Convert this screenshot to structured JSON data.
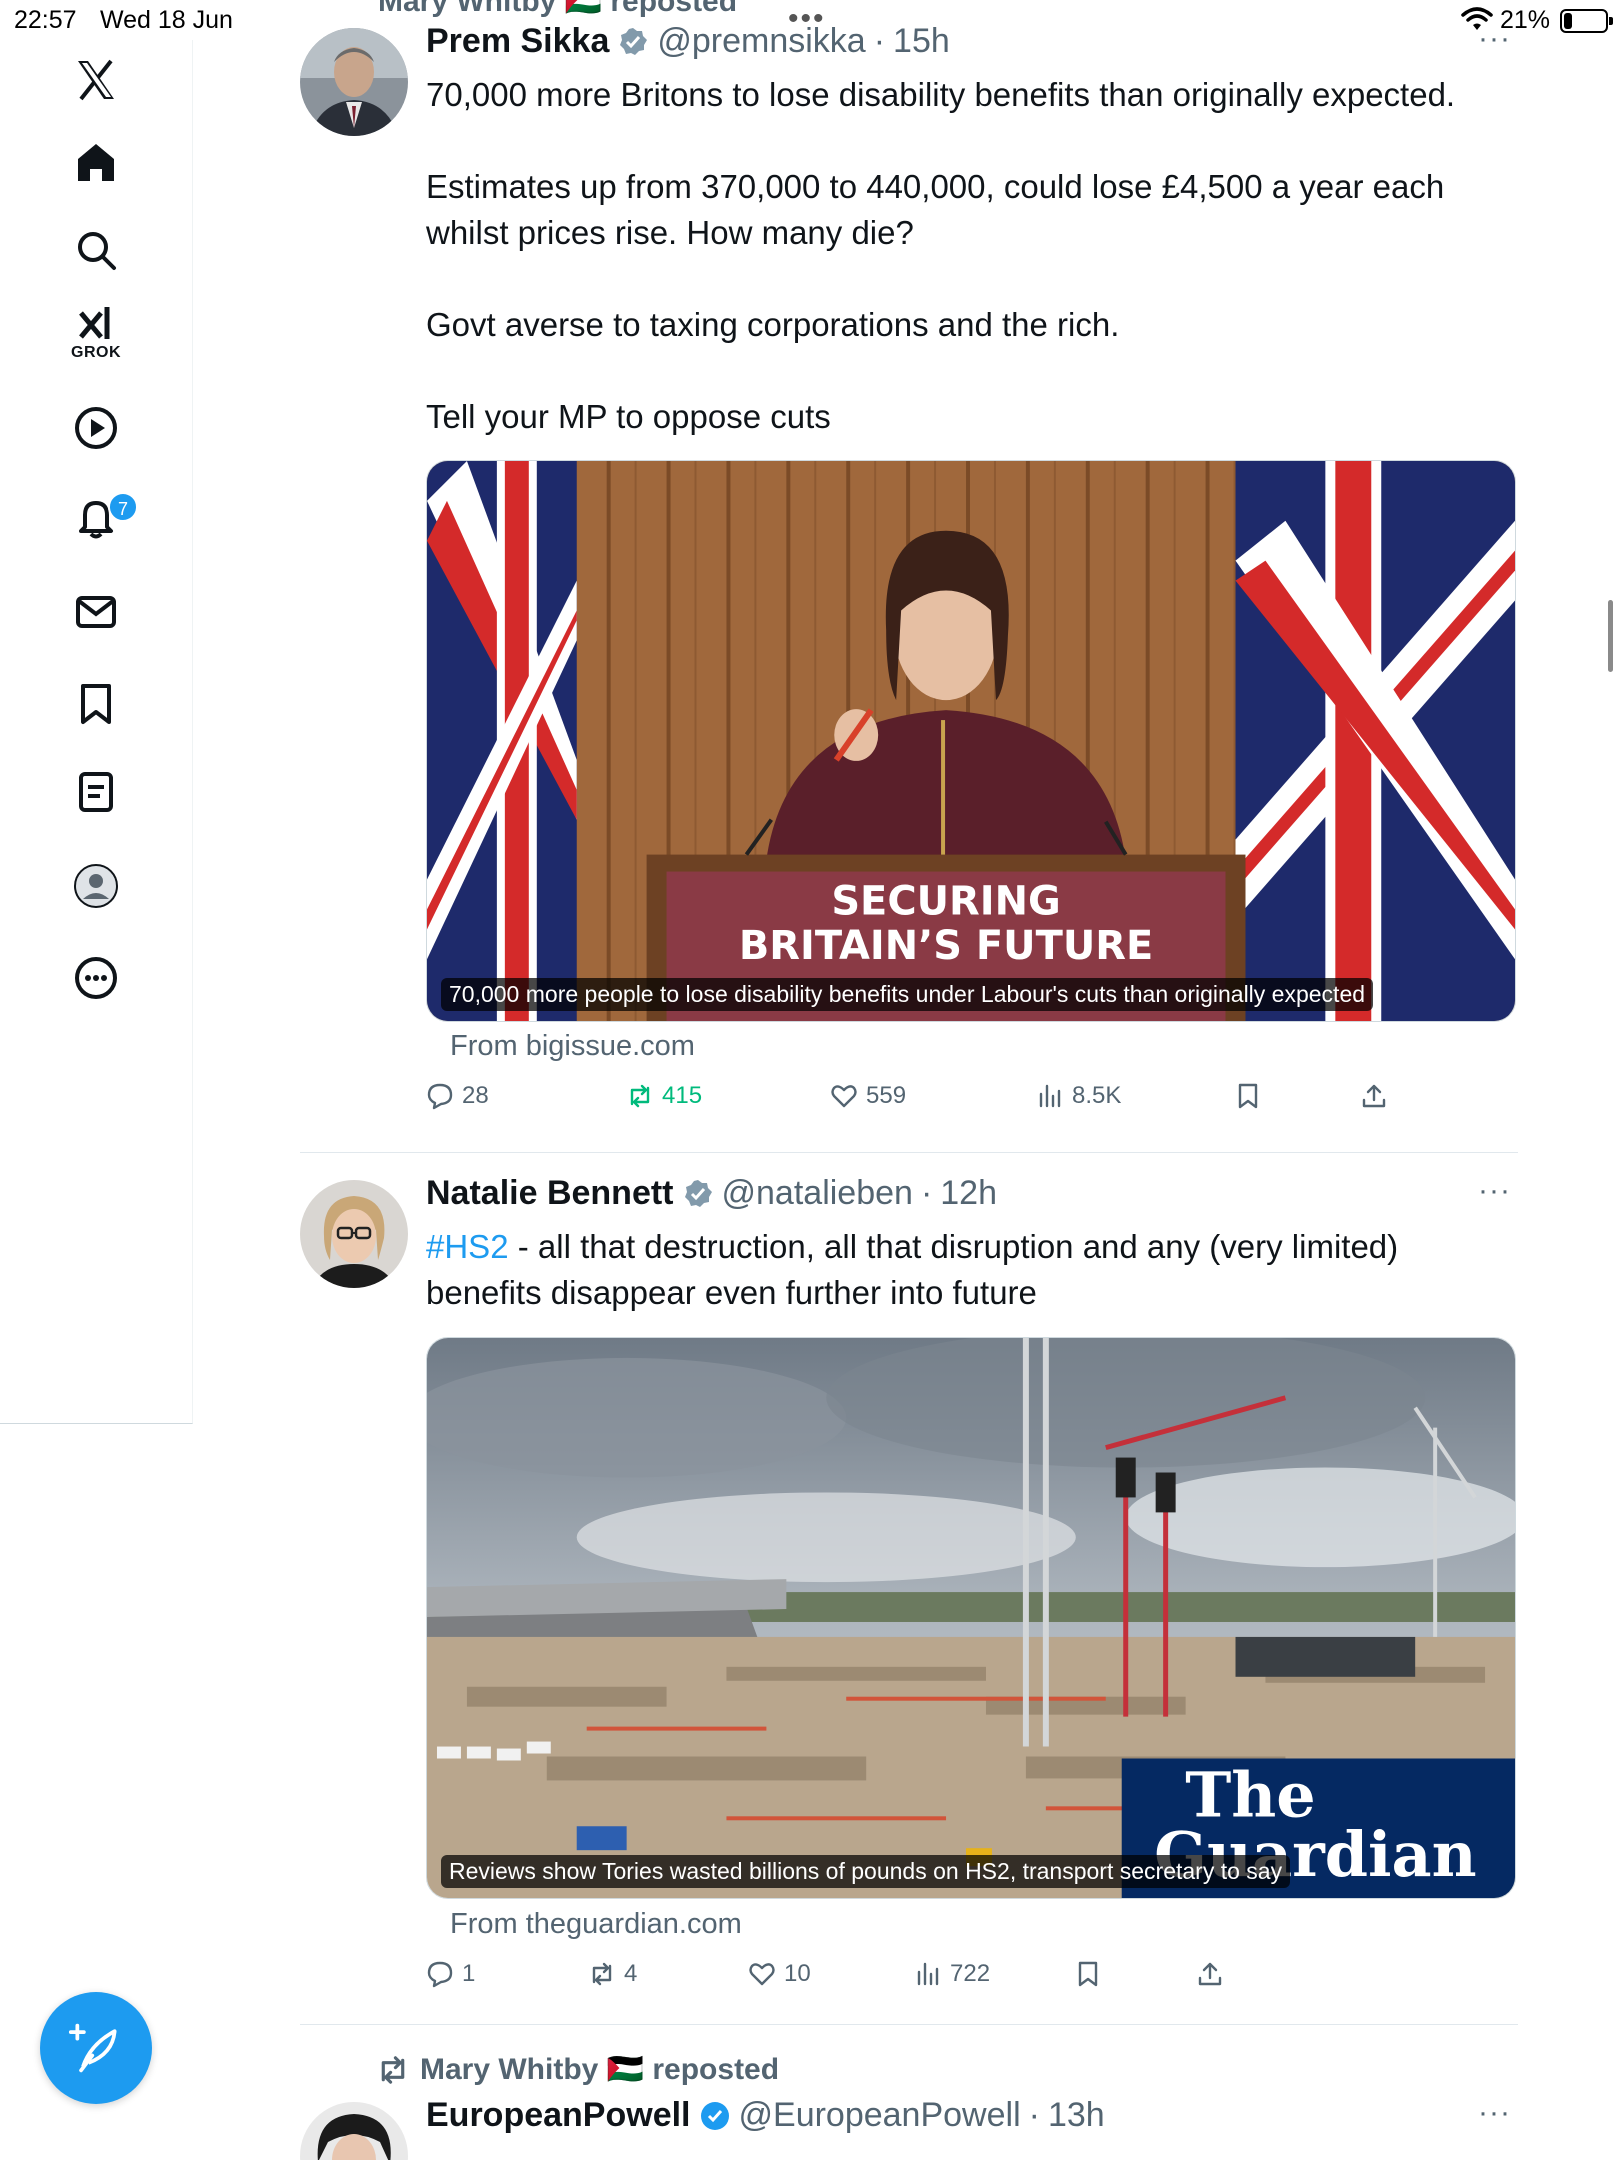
{
  "status_bar": {
    "time": "22:57",
    "date": "Wed 18 Jun",
    "battery_pct": "21%",
    "battery_level": 0.21
  },
  "sidebar": {
    "items": [
      {
        "name": "x-logo",
        "icon": "x-logo-icon"
      },
      {
        "name": "home",
        "icon": "home-icon"
      },
      {
        "name": "search",
        "icon": "search-icon"
      },
      {
        "name": "grok",
        "icon": "grok-icon",
        "label": "GROK"
      },
      {
        "name": "video",
        "icon": "play-icon"
      },
      {
        "name": "notifications",
        "icon": "bell-icon",
        "badge": "7"
      },
      {
        "name": "messages",
        "icon": "envelope-icon"
      },
      {
        "name": "bookmarks",
        "icon": "bookmark-icon"
      },
      {
        "name": "lists",
        "icon": "list-icon"
      },
      {
        "name": "profile",
        "icon": "profile-icon"
      },
      {
        "name": "more",
        "icon": "more-circle-icon"
      }
    ],
    "compose_icon": "feather-plus-icon"
  },
  "feed": {
    "top_repost": "Mary Whitby 🇵🇸 reposted",
    "tweets": [
      {
        "author": "Prem Sikka",
        "handle": "@premnsikka",
        "time": "15h",
        "verified": true,
        "text_paragraphs": [
          "70,000 more Britons to lose disability benefits than originally expected.",
          "Estimates up from 370,000 to 440,000, could lose £4,500 a year each whilst prices rise. How many die?",
          "Govt averse to taxing corporations and the rich.",
          "Tell your MP to oppose cuts"
        ],
        "card": {
          "podium_line1": "SECURING",
          "podium_line2": "BRITAIN’S FUTURE",
          "caption": "70,000 more people to lose disability benefits under Labour's cuts than originally expected",
          "source": "From bigissue.com"
        },
        "stats": {
          "replies": "28",
          "reposts": "415",
          "likes": "559",
          "views": "8.5K"
        }
      },
      {
        "author": "Natalie Bennett",
        "handle": "@natalieben",
        "time": "12h",
        "verified": true,
        "hashtag": "#HS2",
        "text_rest": " - all that destruction, all that disruption and any (very limited) benefits disappear even further into future",
        "card": {
          "logo_line1": "The",
          "logo_line2": "Guardian",
          "caption": "Reviews show Tories wasted billions of pounds on HS2, transport secretary to say",
          "source": "From theguardian.com"
        },
        "stats": {
          "replies": "1",
          "reposts": "4",
          "likes": "10",
          "views": "722"
        }
      },
      {
        "repost_label": "Mary Whitby 🇵🇸 reposted",
        "author": "EuropeanPowell",
        "handle": "@EuropeanPowell",
        "time": "13h",
        "verified": true
      }
    ],
    "separator": "·",
    "more": "···"
  },
  "colors": {
    "accent": "#1d9bf0",
    "repost_green": "#00ba7c",
    "secondary_text": "#536471"
  }
}
